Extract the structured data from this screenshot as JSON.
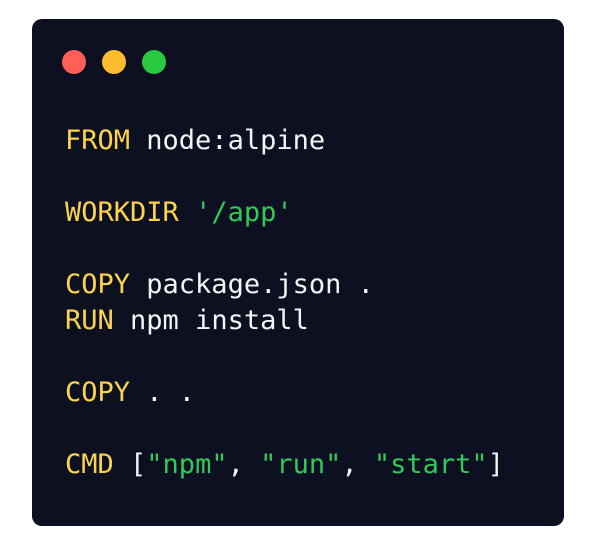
{
  "window": {
    "controls": [
      {
        "name": "close",
        "color": "#ff5f57"
      },
      {
        "name": "minimize",
        "color": "#febc2e"
      },
      {
        "name": "maximize",
        "color": "#28c840"
      }
    ]
  },
  "code": {
    "lines": [
      {
        "kw": "FROM",
        "rest": " node:alpine"
      },
      {
        "kw": "WORKDIR",
        "str": "'/app'"
      },
      {
        "kw": "COPY",
        "rest": " package.json ."
      },
      {
        "kw": "RUN",
        "rest": " npm install"
      },
      {
        "kw": "COPY",
        "rest": " . ."
      },
      {
        "kw": "CMD",
        "open": " [",
        "s1": "\"npm\"",
        "sep1": ", ",
        "s2": "\"run\"",
        "sep2": ", ",
        "s3": "\"start\"",
        "close": "]"
      }
    ]
  }
}
